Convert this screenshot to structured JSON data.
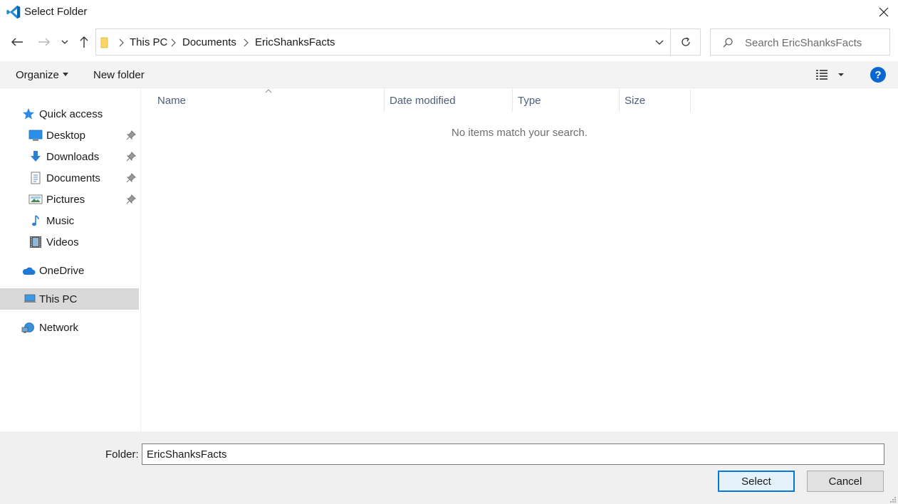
{
  "window": {
    "title": "Select Folder",
    "icon": "vscode-icon",
    "close_icon": "close-icon"
  },
  "navigation": {
    "back_icon": "back-arrow-icon",
    "forward_icon": "forward-arrow-icon",
    "recent_icon": "chevron-down-icon",
    "up_icon": "up-arrow-icon",
    "breadcrumbs": [
      "This PC",
      "Documents",
      "EricShanksFacts"
    ],
    "refresh_icon": "refresh-icon",
    "search_placeholder": "Search EricShanksFacts"
  },
  "toolbar": {
    "organize_label": "Organize",
    "new_folder_label": "New folder",
    "view_icon": "details-view-icon",
    "help_label": "?"
  },
  "sidebar": {
    "items": [
      {
        "label": "Quick access",
        "icon": "star-icon",
        "pinned": false
      },
      {
        "label": "Desktop",
        "icon": "desktop-icon",
        "pinned": true
      },
      {
        "label": "Downloads",
        "icon": "download-icon",
        "pinned": true
      },
      {
        "label": "Documents",
        "icon": "document-icon",
        "pinned": true
      },
      {
        "label": "Pictures",
        "icon": "pictures-icon",
        "pinned": true
      },
      {
        "label": "Music",
        "icon": "music-icon",
        "pinned": false
      },
      {
        "label": "Videos",
        "icon": "videos-icon",
        "pinned": false
      },
      {
        "label": "OneDrive",
        "icon": "cloud-icon",
        "pinned": false
      },
      {
        "label": "This PC",
        "icon": "computer-icon",
        "pinned": false,
        "selected": true
      },
      {
        "label": "Network",
        "icon": "network-icon",
        "pinned": false
      }
    ]
  },
  "file_list": {
    "columns": [
      "Name",
      "Date modified",
      "Type",
      "Size"
    ],
    "empty_message": "No items match your search."
  },
  "footer": {
    "folder_label": "Folder:",
    "folder_value": "EricShanksFacts",
    "select_label": "Select",
    "cancel_label": "Cancel"
  },
  "colors": {
    "accent": "#0078d7",
    "selected_bg": "#d9d9d9",
    "help_blue": "#0a66d0"
  }
}
